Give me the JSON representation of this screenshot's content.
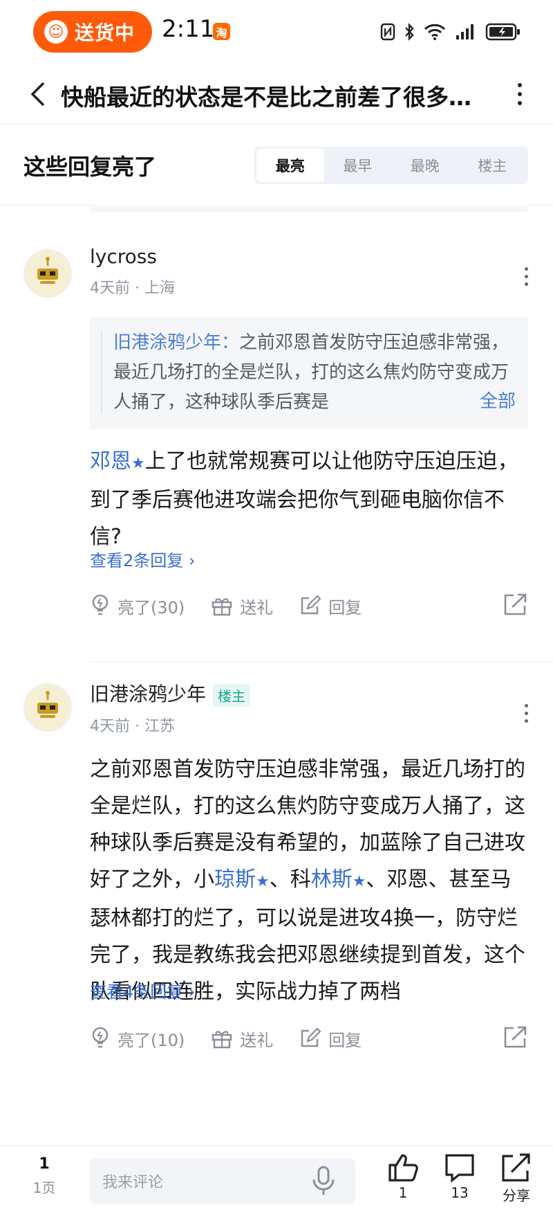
{
  "status_bar": {
    "delivery_label": "送货中",
    "time": "2:11",
    "app_badge": "淘"
  },
  "nav": {
    "title": "快船最近的状态是不是比之前差了很多…"
  },
  "replies_header": {
    "title": "这些回复亮了",
    "sort_tabs": [
      "最亮",
      "最早",
      "最晚",
      "楼主"
    ],
    "active_tab": "最亮"
  },
  "posts": [
    {
      "username": "lycross",
      "meta": "4天前 · 上海",
      "quote": {
        "author": "旧港涂鸦少年：",
        "text": "之前邓恩首发防守压迫感非常强，最近几场打的全是烂队，打的这么焦灼防守变成万人捅了，这种球队季后赛是",
        "expand": "全部"
      },
      "body_link": "邓恩",
      "body_text": "上了也就常规赛可以让他防守压迫压迫，到了季后赛他进攻端会把你气到砸电脑你信不信?",
      "view_replies": "查看2条回复 ›",
      "actions": {
        "like": "亮了(30)",
        "gift": "送礼",
        "reply": "回复"
      }
    },
    {
      "username": "旧港涂鸦少年",
      "op_badge": "楼主",
      "meta": "4天前 · 江苏",
      "body_parts": {
        "p1": "之前邓恩首发防守压迫感非常强，最近几场打的全是烂队，打的这么焦灼防守变成万人捅了，这种球队季后赛是没有希望的，加蓝除了自己进攻好了之外，小",
        "link1": "琼斯",
        "p2": "、科",
        "link2": "林斯",
        "p3": "、邓恩、甚至马瑟林都打的烂了，可以说是进攻4换一，防守烂完了，我是教练我会把邓恩继续提到首发，这个队看似四连胜，实际战力掉了两档"
      },
      "view_replies": "查看4条回复 ›",
      "actions": {
        "like": "亮了(10)",
        "gift": "送礼",
        "reply": "回复"
      }
    }
  ],
  "bottom_bar": {
    "page_number": "1",
    "page_label": "1页",
    "comment_placeholder": "我来评论",
    "like_count": "1",
    "comment_count": "13",
    "share_label": "分享"
  }
}
